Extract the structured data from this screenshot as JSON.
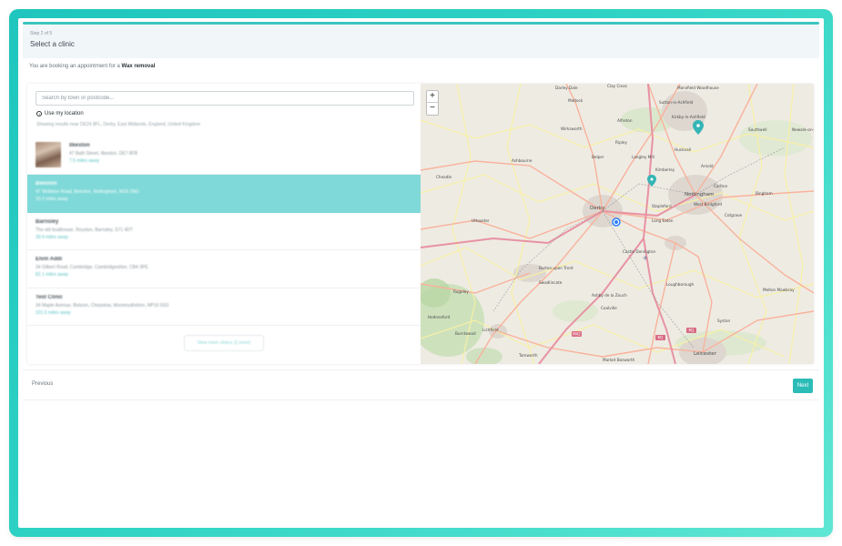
{
  "step": {
    "label": "Step 2 of 5",
    "title": "Select a clinic",
    "progress_percent": 100
  },
  "booking": {
    "prefix": "You are booking an appointment for a",
    "service": "Wax removal"
  },
  "search": {
    "placeholder": "Search by town or postcode...",
    "use_location_label": "Use my location",
    "showing_text": "Showing results near DE24 8FL, Derby, East Midlands, England, United Kingdom"
  },
  "clinics": [
    {
      "name": "Ilkeston",
      "address": "47 Bath Street, Ilkeston, DE7 8FB",
      "distance": "7.5 miles away",
      "has_thumb": true,
      "selected": false
    },
    {
      "name": "Beeston",
      "address": "47 Wollaton Road, Beeston, Nottingham, NG9 2NG",
      "distance": "10.2 miles away",
      "has_thumb": false,
      "selected": true
    },
    {
      "name": "Barnsley",
      "address": "The old boathouse, Royston, Barnsley, S71 4DT",
      "distance": "39.9 miles away",
      "has_thumb": false,
      "selected": false
    },
    {
      "name": "Elvin Addi",
      "address": "34 Gilbert Road, Cambridge, Cambridgeshire, CB4 3PE",
      "distance": "82.1 miles away",
      "has_thumb": false,
      "selected": false
    },
    {
      "name": "Test Clinic",
      "address": "34 Maple Avenue, Bolsom, Chepstow, Monmouthshire, NP16 5SG",
      "distance": "101.5 miles away",
      "has_thumb": false,
      "selected": false
    }
  ],
  "view_more_label": "View more clinics (3 more)",
  "map": {
    "zoom_in": "+",
    "zoom_out": "−",
    "labels": [
      "Darley Dale",
      "Clay Cross",
      "Mansfield Woodhouse",
      "Matlock",
      "Sutton-in-Ashfield",
      "Kirkby-in-Ashfield",
      "Alfreton",
      "Wirksworth",
      "Southwell",
      "Newark-on-Trent",
      "Ripley",
      "Hucknall",
      "Ashbourne",
      "Belper",
      "Langley Mill",
      "Kimberley",
      "Arnold",
      "Cheadle",
      "Carlton",
      "Nottingham",
      "Derby",
      "Bingham",
      "Uttoxeter",
      "Stapleford",
      "West Bridgford",
      "Long Eaton",
      "Cotgrave",
      "Castle Donington",
      "Burton upon Trent",
      "Swadlincote",
      "Ashby de la Zouch",
      "Loughborough",
      "Melton Mowbray",
      "Coalville",
      "Hednesford",
      "Rugeley",
      "Burntwood",
      "Lichfield",
      "Syston",
      "Tamworth",
      "Leicester",
      "Market Bosworth"
    ],
    "road_badges": [
      "M42",
      "M1",
      "M1"
    ],
    "colors": {
      "land": "#eeebe3",
      "motorway": "#e892a2",
      "primary_road": "#f9b29c",
      "secondary_road": "#f7f0a5",
      "urban": "#ddd7d0",
      "forest": "#c7dfb6",
      "marker": "#35b5b5",
      "user_location": "#2a7fff"
    }
  },
  "footer": {
    "previous_label": "Previous",
    "next_label": "Next"
  },
  "colors": {
    "accent": "#2cbcb8",
    "selected_row": "#7fd9d8",
    "frame_gradient_start": "#1fc6bd",
    "frame_gradient_end": "#5ee6d3"
  }
}
